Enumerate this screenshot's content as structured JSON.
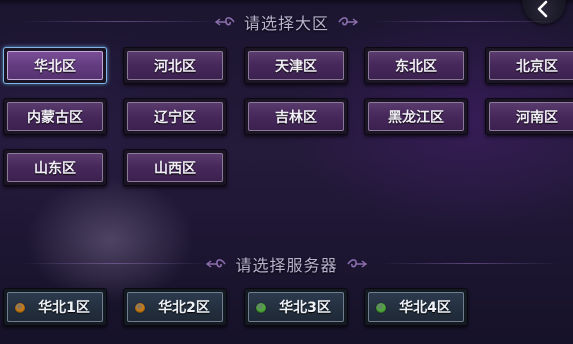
{
  "region_section": {
    "title": "请选择大区",
    "regions": [
      {
        "label": "华北区",
        "selected": true
      },
      {
        "label": "河北区",
        "selected": false
      },
      {
        "label": "天津区",
        "selected": false
      },
      {
        "label": "东北区",
        "selected": false
      },
      {
        "label": "北京区",
        "selected": false
      },
      {
        "label": "内蒙古区",
        "selected": false
      },
      {
        "label": "辽宁区",
        "selected": false
      },
      {
        "label": "吉林区",
        "selected": false
      },
      {
        "label": "黑龙江区",
        "selected": false
      },
      {
        "label": "河南区",
        "selected": false
      },
      {
        "label": "山东区",
        "selected": false
      },
      {
        "label": "山西区",
        "selected": false
      }
    ]
  },
  "server_section": {
    "title": "请选择服务器",
    "servers": [
      {
        "label": "华北1区",
        "status_color": "#c77a16"
      },
      {
        "label": "华北2区",
        "status_color": "#c77a16"
      },
      {
        "label": "华北3区",
        "status_color": "#4fa83a"
      },
      {
        "label": "华北4区",
        "status_color": "#4fa83a"
      }
    ]
  },
  "icons": {
    "back": "chevron-left-icon",
    "ornament": "scroll-ornament-icon"
  }
}
